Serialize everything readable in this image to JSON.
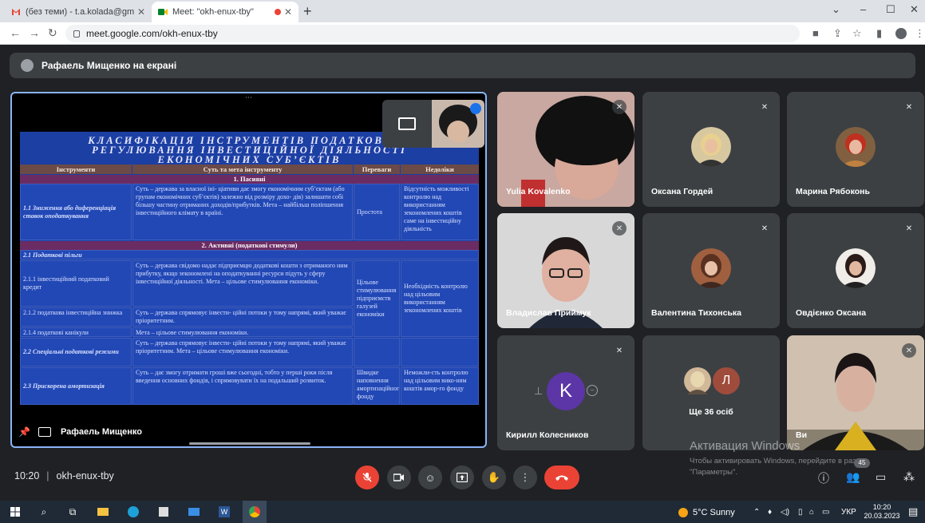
{
  "browser": {
    "tabs": [
      {
        "title": "(без теми) - t.a.kolada@gmail.c",
        "active": false
      },
      {
        "title": "Meet: \"okh-enux-tby\"",
        "active": true
      }
    ],
    "new_tab": "+",
    "url": "meet.google.com/okh-enux-tby",
    "window_controls": {
      "minimize": "⌄",
      "restore": "–",
      "maximize": "☐",
      "close": "✕"
    }
  },
  "meet": {
    "presenting_banner": "Рафаель Мищенко на екрані",
    "presenter_name": "Рафаель Мищенко",
    "slide": {
      "title_lines": [
        "КЛАСИФІКАЦІЯ ІНСТРУМЕНТІВ ПОДАТКОВОГО",
        "РЕГУЛЮВАННЯ ІНВЕСТИЦІЙНОЇ ДІЯЛЬНОСТІ",
        "ЕКОНОМІЧНИХ СУБ’ЄКТІВ"
      ],
      "headers": [
        "Інструменти",
        "Суть та мета інструменту",
        "Переваги",
        "Недоліки"
      ],
      "section1": "1. Пасивні",
      "row1": {
        "instrument": "1.1 Зниження або диференціація ставок оподаткування",
        "essence": "Суть – держава за власної іні- ціативи дає змогу економічним суб’єктам (або групам економічних суб’єктів) залежно від розміру дохо- дів) залишати собі більшу частину отриманих доходів/прибутків. Мета – найбільш поліпшення інвестиційного клімату в країні.",
        "advantages": "Простота",
        "disadvantages": "Відсутність можливості контролю над використанням зекономлених коштів саме на інвестиційну діяльність"
      },
      "section2": "2. Активні (податкові стимули)",
      "subsection": "2.1 Податкові пільги",
      "row2": {
        "instrument": "2.1.1 інвестиційний податковий кредит",
        "essence": "Суть – держава свідомо надає підприємцю додаткові кошти з отриманого ним прибутку, якщо зекономлені на оподаткуванні ресурси підуть у сферу інвестиційної діяльності. Мета – цільове стимулювання економіки."
      },
      "row3": {
        "instrument": "2.1.2 податкова інвестиційна знижка",
        "essence": "Суть – держава спрямовує інвести- ційні потоки у тому напрямі, який уважає пріоритетним."
      },
      "row4": {
        "instrument": "2.1.4 податкові канікули",
        "essence": "Мета – цільове стимулювання економіки."
      },
      "group_adv": "Цільове стимулювання підприємств галузей економіки",
      "group_dis": "Необхідність контролю над цільовим використанням зекономлених коштів",
      "row5": {
        "instrument": "2.2 Спеціальні податкові режими",
        "essence": "Суть – держава спрямовує інвести- ційні потоки у тому напрямі, який уважає пріоритетним. Мета – цільове стимулювання економіки."
      },
      "row6": {
        "instrument": "2.3 Прискорена амортизація",
        "essence": "Суть – дає змогу отримати гроші вже сьогодні, тобто у перші роки після введення основних фондів, і спрямовувати їх на подальший розвиток.",
        "advantages": "Швидке наповнення амортизаційного фонду",
        "disadvantages": "Неможли-сть контролю над цільовим вико-ням коштів амор-го фонду"
      }
    },
    "participants": [
      {
        "name": "Yulia Kovalenko",
        "muted": true,
        "type": "video"
      },
      {
        "name": "Оксана Гордей",
        "muted": true,
        "type": "avatar"
      },
      {
        "name": "Марина Рябоконь",
        "muted": true,
        "type": "avatar"
      },
      {
        "name": "Владислав Приймук",
        "muted": true,
        "type": "video"
      },
      {
        "name": "Валентина Тихонська",
        "muted": true,
        "type": "avatar"
      },
      {
        "name": "Овдієнко Оксана",
        "muted": true,
        "type": "avatar"
      },
      {
        "name": "Кирилл Колесников",
        "muted": true,
        "type": "letter",
        "letter": "K"
      },
      {
        "name": "Ще 36 осіб",
        "muted": false,
        "type": "more",
        "letter": "Л"
      },
      {
        "name": "Ви",
        "muted": true,
        "type": "video"
      }
    ],
    "time": "10:20",
    "meeting_code": "okh-enux-tby",
    "participant_count": "45",
    "activation": {
      "title": "Активация Windows",
      "text": "Чтобы активировать Windows, перейдите в раздел \"Параметры\"."
    }
  },
  "taskbar": {
    "weather": "5°C Sunny",
    "lang": "УКР",
    "time": "10:20",
    "date": "20.03.2023"
  },
  "colors": {
    "accent_blue": "#8ab4f8",
    "end_call_red": "#ea4335",
    "slide_bg": "#1c3fa3"
  }
}
